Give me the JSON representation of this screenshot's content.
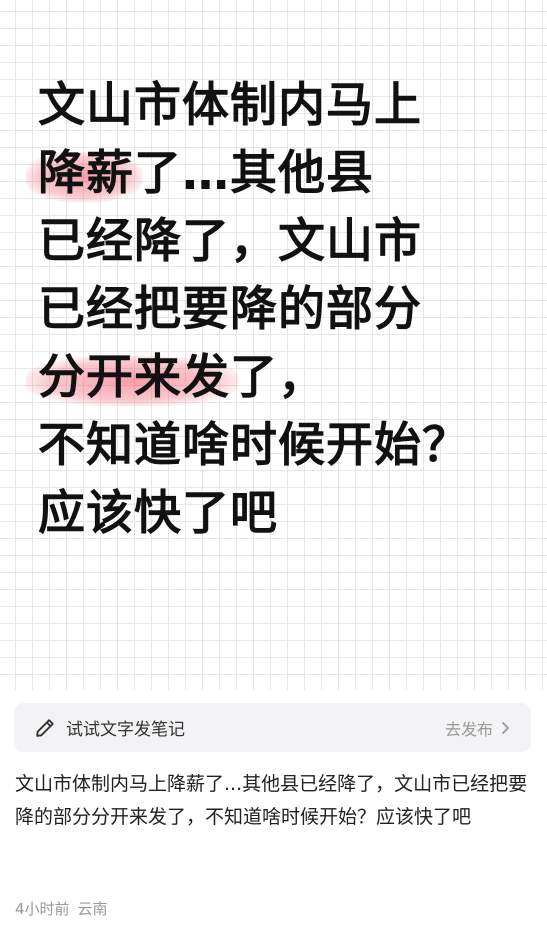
{
  "note_image": {
    "lines": [
      {
        "pre": "文山市体制内马上",
        "hl": "",
        "post": ""
      },
      {
        "pre": "",
        "hl": "降薪",
        "post": "了…其他县"
      },
      {
        "pre": "已经降了，文山市",
        "hl": "",
        "post": ""
      },
      {
        "pre": "已经把要降的部分",
        "hl": "",
        "post": ""
      },
      {
        "pre": "",
        "hl": "分开来发",
        "post": "了，"
      },
      {
        "pre": "不知道啥时候开始？",
        "hl": "",
        "post": ""
      },
      {
        "pre": "应该快了吧",
        "hl": "",
        "post": ""
      }
    ]
  },
  "try_bar": {
    "icon": "pencil-icon",
    "label": "试试文字发笔记",
    "action_label": "去发布",
    "action_icon": "chevron-right-icon"
  },
  "post": {
    "body": "文山市体制内马上降薪了...其他县已经降了，文山市已经把要降的部分分开来发了，不知道啥时候开始？应该快了吧",
    "time": "4小时前",
    "location": "云南"
  },
  "colors": {
    "highlight": "#f05064",
    "grid": "#e6e6e6",
    "muted": "#999999"
  }
}
